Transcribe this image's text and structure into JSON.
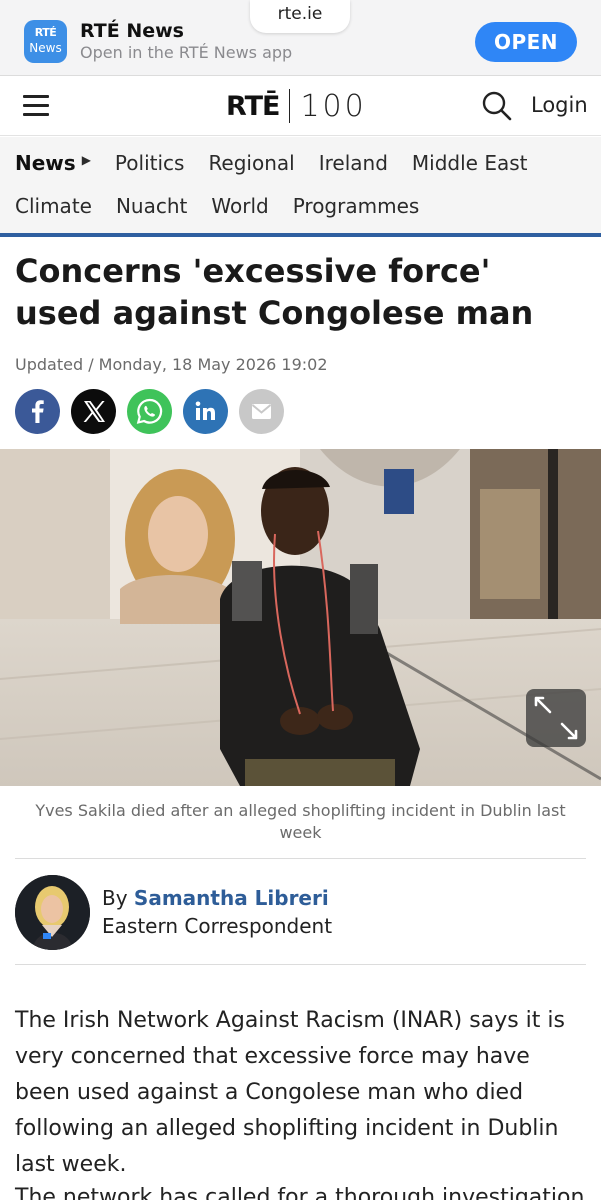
{
  "browser": {
    "url": "rte.ie"
  },
  "app_banner": {
    "icon_line1": "RTÉ",
    "icon_line2": "News",
    "title": "RTÉ News",
    "subtitle": "Open in the RTÉ News app",
    "open_label": "OPEN"
  },
  "header": {
    "logo_brand": "RTĒ",
    "logo_number": "100",
    "login_label": "Login"
  },
  "nav": {
    "row1": [
      "News",
      "Politics",
      "Regional",
      "Ireland",
      "Middle East"
    ],
    "row2": [
      "Climate",
      "Nuacht",
      "World",
      "Programmes"
    ],
    "active": "News"
  },
  "article": {
    "headline": "Concerns 'excessive force' used against Congolese man",
    "dateline": "Updated / Monday, 18 May 2026 19:02",
    "share_buttons": [
      "facebook-icon",
      "x-icon",
      "whatsapp-icon",
      "linkedin-icon",
      "email-icon"
    ],
    "image_caption": "Yves Sakila died after an alleged shoplifting incident in Dublin last week",
    "author": {
      "by": "By",
      "name": "Samantha Libreri",
      "role": "Eastern Correspondent"
    },
    "paragraphs": [
      "The Irish Network Against Racism (INAR) says it is very concerned that excessive force may have been used against a Congolese man who died following an alleged shoplifting incident in Dublin last week.",
      "The network has called for a thorough investigation"
    ]
  },
  "colors": {
    "open_button": "#2f86f6",
    "nav_border": "#2f5fa0",
    "author_link": "#2e5d98"
  }
}
